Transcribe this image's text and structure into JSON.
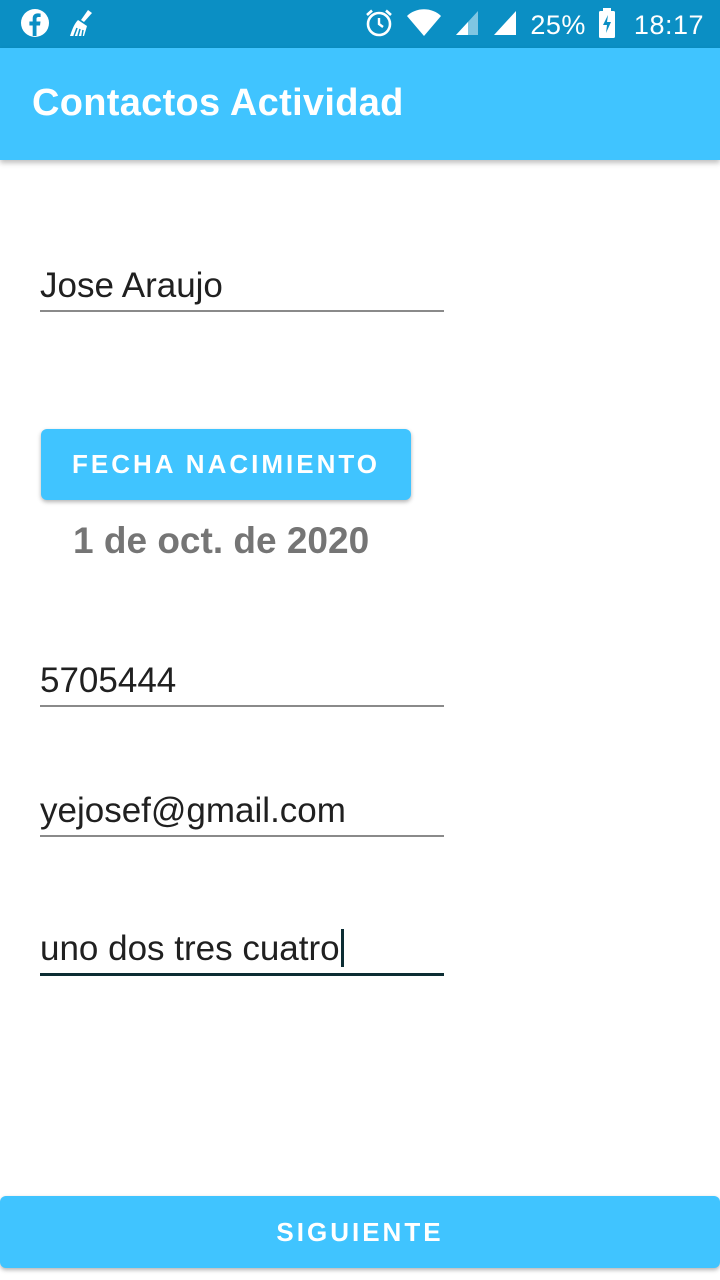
{
  "status_bar": {
    "battery": "25%",
    "time": "18:17",
    "icons": [
      "facebook-icon",
      "cleaner-broom-icon",
      "alarm-icon",
      "wifi-icon",
      "signal-icon",
      "signal-icon",
      "battery-charging-icon"
    ]
  },
  "app_bar": {
    "title": "Contactos Actividad"
  },
  "form": {
    "name_value": "Jose Araujo",
    "date_button_label": "FECHA NACIMIENTO",
    "date_value": "1 de oct. de 2020",
    "phone_value": "5705444",
    "email_value": "yejosef@gmail.com",
    "description_value": "uno dos tres cuatro"
  },
  "footer": {
    "next_button_label": "SIGUIENTE"
  },
  "colors": {
    "status_bar": "#0b8fc4",
    "accent": "#40c4ff",
    "date_text": "#757575"
  }
}
